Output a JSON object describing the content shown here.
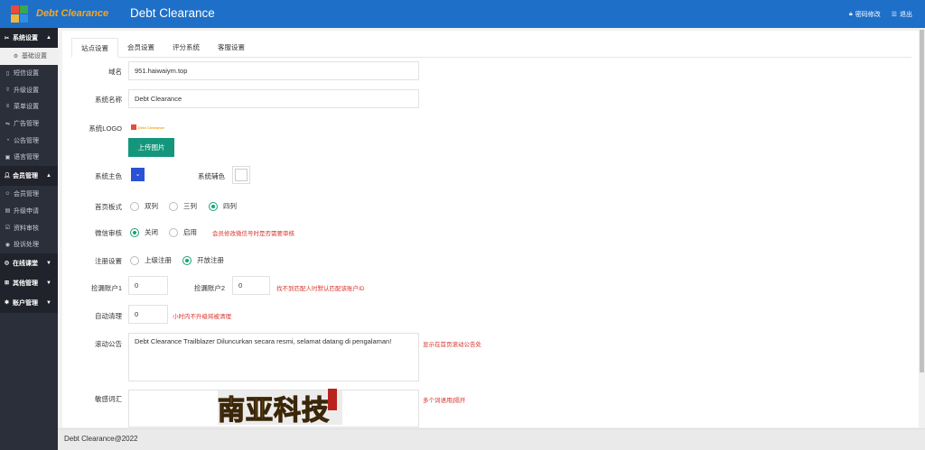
{
  "header": {
    "brand": "Debt Clearance",
    "title": "Debt Clearance",
    "change_password": "密码修改",
    "logout": "退出"
  },
  "sidebar": {
    "groups": [
      {
        "label": "系统设置",
        "items": [
          "基础设置",
          "短信设置",
          "升级设置",
          "菜单设置",
          "广告管理",
          "公告管理",
          "语言管理"
        ]
      },
      {
        "label": "会员管理",
        "items": [
          "会员管理",
          "升级申请",
          "资料审核",
          "投诉处理"
        ]
      },
      {
        "label": "在线课堂",
        "items": []
      },
      {
        "label": "其他管理",
        "items": []
      },
      {
        "label": "账户管理",
        "items": []
      }
    ]
  },
  "tabs": [
    "站点设置",
    "会员设置",
    "评分系统",
    "客服设置"
  ],
  "form": {
    "domain_label": "域名",
    "domain_value": "951.haiwaiym.top",
    "name_label": "系统名称",
    "name_value": "Debt Clearance",
    "logo_label": "系统LOGO",
    "logo_text": "Debt Clearance",
    "upload_button": "上传图片",
    "primary_color_label": "系统主色",
    "primary_color": "#2a52d8",
    "secondary_color_label": "系统辅色",
    "secondary_color": "#ffffff",
    "layout_label": "首页板式",
    "layout_options": [
      "双列",
      "三列",
      "四列"
    ],
    "layout_selected": "四列",
    "wechat_label": "微信审核",
    "wechat_options": [
      "关闭",
      "启用"
    ],
    "wechat_selected": "关闭",
    "wechat_hint": "会员修改微信号时是否需要审核",
    "register_label": "注册设置",
    "register_options": [
      "上级注册",
      "开放注册"
    ],
    "register_selected": "开放注册",
    "pick1_label": "捡漏账户1",
    "pick1_value": "0",
    "pick2_label": "捡漏账户2",
    "pick2_value": "0",
    "pick_hint": "找不到匹配人时默认匹配该账户ID",
    "auto_clean_label": "自动清理",
    "auto_clean_value": "0",
    "auto_clean_hint": "小时内不升级将被清理",
    "notice_label": "滚动公告",
    "notice_value": "Debt Clearance Trailblazer Diluncurkan secara resmi, selamat datang di pengalaman!",
    "notice_hint": "显示在首页滚动公告处",
    "sensitive_label": "敏感词汇",
    "sensitive_value": "",
    "sensitive_hint": "多个词语用|隔开"
  },
  "footer": {
    "copyright": "Debt Clearance@2022"
  },
  "watermark": {
    "text": "南亚科技"
  }
}
